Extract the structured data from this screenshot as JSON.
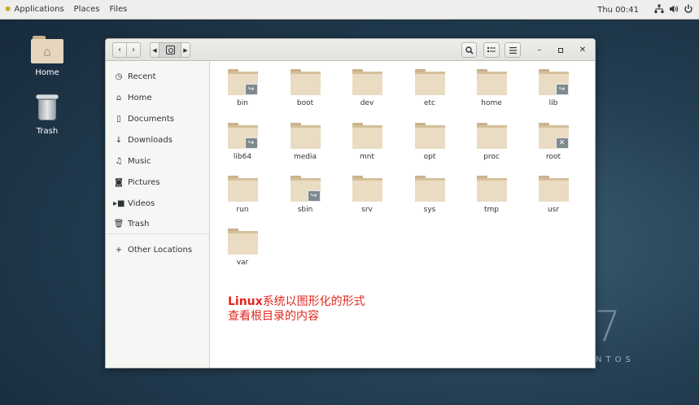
{
  "topbar": {
    "applications": "Applications",
    "places": "Places",
    "files": "Files",
    "clock": "Thu 00:41"
  },
  "desktop": {
    "home": "Home",
    "trash": "Trash",
    "watermark_seven": "7",
    "watermark_word": "NTOS"
  },
  "window": {
    "sidebar": [
      {
        "icon": "clock-icon",
        "label": "Recent"
      },
      {
        "icon": "home-icon",
        "label": "Home"
      },
      {
        "icon": "document-icon",
        "label": "Documents"
      },
      {
        "icon": "download-icon",
        "label": "Downloads"
      },
      {
        "icon": "music-icon",
        "label": "Music"
      },
      {
        "icon": "camera-icon",
        "label": "Pictures"
      },
      {
        "icon": "video-icon",
        "label": "Videos"
      },
      {
        "icon": "trash-icon",
        "label": "Trash"
      }
    ],
    "other_locations": "Other Locations",
    "files": [
      {
        "name": "bin",
        "emblem": "symlink"
      },
      {
        "name": "boot",
        "emblem": ""
      },
      {
        "name": "dev",
        "emblem": ""
      },
      {
        "name": "etc",
        "emblem": ""
      },
      {
        "name": "home",
        "emblem": ""
      },
      {
        "name": "lib",
        "emblem": "symlink"
      },
      {
        "name": "lib64",
        "emblem": "symlink"
      },
      {
        "name": "media",
        "emblem": ""
      },
      {
        "name": "mnt",
        "emblem": ""
      },
      {
        "name": "opt",
        "emblem": ""
      },
      {
        "name": "proc",
        "emblem": ""
      },
      {
        "name": "root",
        "emblem": "locked"
      },
      {
        "name": "run",
        "emblem": ""
      },
      {
        "name": "sbin",
        "emblem": "symlink"
      },
      {
        "name": "srv",
        "emblem": ""
      },
      {
        "name": "sys",
        "emblem": ""
      },
      {
        "name": "tmp",
        "emblem": ""
      },
      {
        "name": "usr",
        "emblem": ""
      },
      {
        "name": "var",
        "emblem": ""
      }
    ]
  },
  "annotation": {
    "line1_bold": "Linux",
    "line1_rest": "系统以图形化的形式",
    "line2": "查看根目录的内容"
  },
  "colors": {
    "annotation": "#e0261d",
    "folder_front": "#eadcc3",
    "folder_back": "#d4bf9b"
  }
}
